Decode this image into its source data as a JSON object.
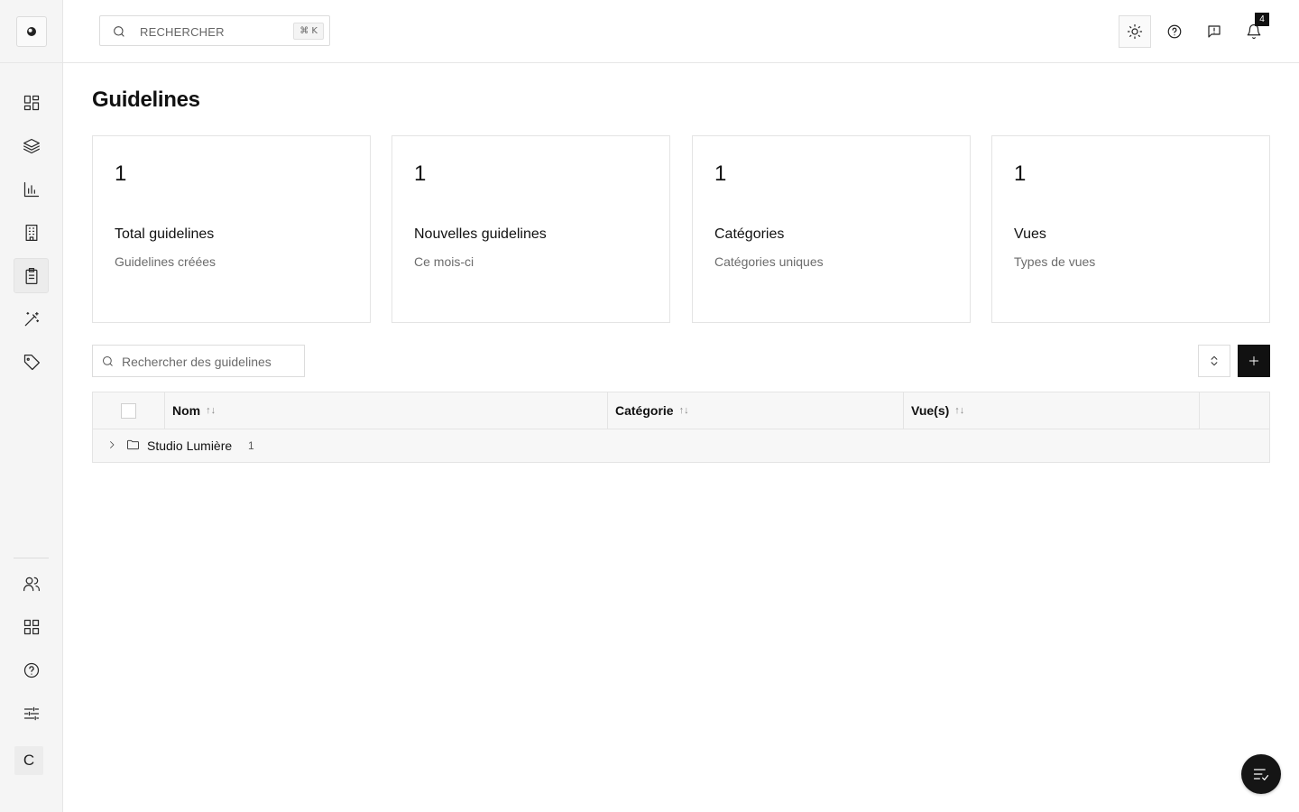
{
  "topbar": {
    "search_placeholder": "RECHERCHER",
    "shortcut": "⌘ K",
    "notifications_count": "4"
  },
  "sidebar": {
    "items": [
      {
        "icon": "dashboard-icon"
      },
      {
        "icon": "layers-icon"
      },
      {
        "icon": "chart-icon"
      },
      {
        "icon": "building-icon"
      },
      {
        "icon": "clipboard-icon",
        "active": true
      },
      {
        "icon": "magic-wand-icon"
      },
      {
        "icon": "tag-icon"
      }
    ],
    "bottom_items": [
      {
        "icon": "users-icon"
      },
      {
        "icon": "apps-icon"
      },
      {
        "icon": "help-icon"
      },
      {
        "icon": "sliders-icon"
      }
    ],
    "avatar_initial": "C"
  },
  "page": {
    "title": "Guidelines"
  },
  "stats": [
    {
      "value": "1",
      "title": "Total guidelines",
      "subtitle": "Guidelines créées"
    },
    {
      "value": "1",
      "title": "Nouvelles guidelines",
      "subtitle": "Ce mois-ci"
    },
    {
      "value": "1",
      "title": "Catégories",
      "subtitle": "Catégories uniques"
    },
    {
      "value": "1",
      "title": "Vues",
      "subtitle": "Types de vues"
    }
  ],
  "table": {
    "search_placeholder": "Rechercher des guidelines",
    "columns": [
      "Nom",
      "Catégorie",
      "Vue(s)"
    ],
    "groups": [
      {
        "name": "Studio Lumière",
        "count": "1",
        "expanded": false
      }
    ]
  }
}
